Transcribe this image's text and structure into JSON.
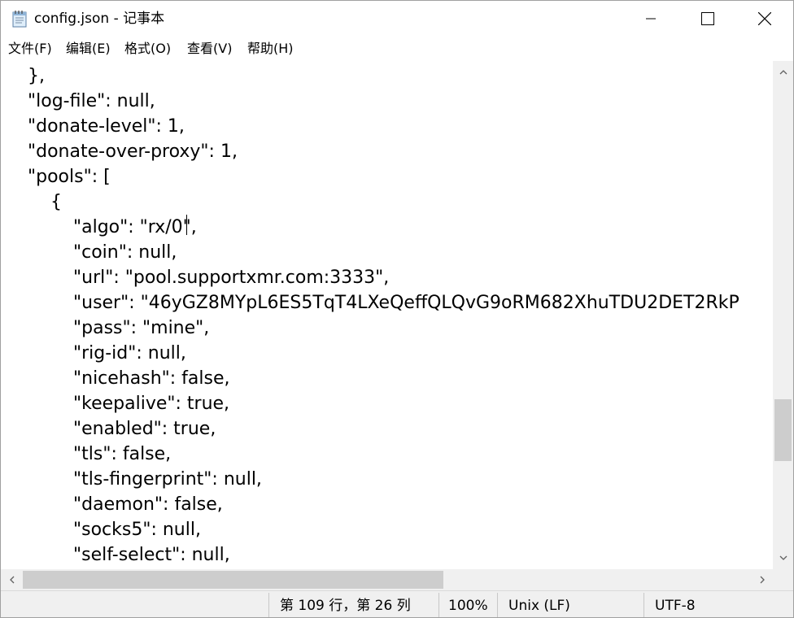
{
  "window": {
    "title": "config.json - 记事本"
  },
  "menu": [
    {
      "label": "文件(F)"
    },
    {
      "label": "编辑(E)"
    },
    {
      "label": "格式(O)"
    },
    {
      "label": "查看(V)"
    },
    {
      "label": "帮助(H)"
    }
  ],
  "editor": {
    "lines": [
      "},",
      "\"log-file\": null,",
      "\"donate-level\": 1,",
      "\"donate-over-proxy\": 1,",
      "\"pools\": [",
      "{",
      "\"algo\": \"rx/0\",",
      "\"coin\": null,",
      "\"url\": \"pool.supportxmr.com:3333\",",
      "\"user\": \"46yGZ8MYpL6ES5TqT4LXeQeffQLQvG9oRM682XhuTDU2DET2RkP",
      "\"pass\": \"mine\",",
      "\"rig-id\": null,",
      "\"nicehash\": false,",
      "\"keepalive\": true,",
      "\"enabled\": true,",
      "\"tls\": false,",
      "\"tls-fingerprint\": null,",
      "\"daemon\": false,",
      "\"socks5\": null,",
      "\"self-select\": null,"
    ]
  },
  "status": {
    "position": "第 109 行，第 26 列",
    "zoom": "100%",
    "line_ending": "Unix (LF)",
    "encoding": "UTF-8"
  },
  "icons": {
    "app": "notepad-icon",
    "minimize": "minimize-icon",
    "maximize": "maximize-icon",
    "close": "close-icon"
  }
}
